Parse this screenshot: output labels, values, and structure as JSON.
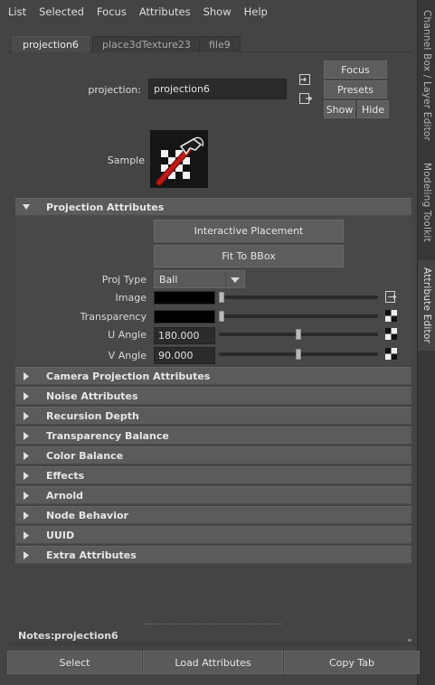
{
  "menubar": {
    "items": [
      "List",
      "Selected",
      "Focus",
      "Attributes",
      "Show",
      "Help"
    ]
  },
  "tabs": [
    {
      "label": "projection6",
      "active": true
    },
    {
      "label": "place3dTexture23",
      "active": false
    },
    {
      "label": "file9",
      "active": false
    }
  ],
  "side_tabs": [
    {
      "label": "Channel Box / Layer Editor",
      "active": false
    },
    {
      "label": "Modeling Toolkit",
      "active": false
    },
    {
      "label": "Attribute Editor",
      "active": true
    }
  ],
  "header": {
    "node_label": "projection:",
    "node_name": "projection6",
    "focus_label": "Focus",
    "presets_label": "Presets",
    "show_label": "Show",
    "hide_label": "Hide",
    "sample_label": "Sample"
  },
  "projection": {
    "title": "Projection Attributes",
    "expanded": true,
    "interactive_label": "Interactive Placement",
    "fit_label": "Fit To BBox",
    "proj_type_label": "Proj Type",
    "proj_type_value": "Ball",
    "image_label": "Image",
    "image_color": "#000000",
    "transparency_label": "Transparency",
    "transparency_color": "#000000",
    "u_angle_label": "U Angle",
    "u_angle_value": "180.000",
    "v_angle_label": "V Angle",
    "v_angle_value": "90.000",
    "image_slider": 0.0,
    "transparency_slider": 0.0,
    "u_angle_slider": 0.5,
    "v_angle_slider": 0.5
  },
  "sections": [
    "Camera Projection Attributes",
    "Noise Attributes",
    "Recursion Depth",
    "Transparency Balance",
    "Color Balance",
    "Effects",
    "Arnold",
    "Node Behavior",
    "UUID",
    "Extra Attributes"
  ],
  "notes": {
    "label": "Notes:",
    "value": "projection6"
  },
  "bottom_buttons": {
    "select": "Select",
    "load": "Load Attributes",
    "copy_tab": "Copy Tab"
  },
  "colors": {
    "background": "#444444",
    "frame_header": "#5b5b5b",
    "field": "#2b2b2b"
  }
}
